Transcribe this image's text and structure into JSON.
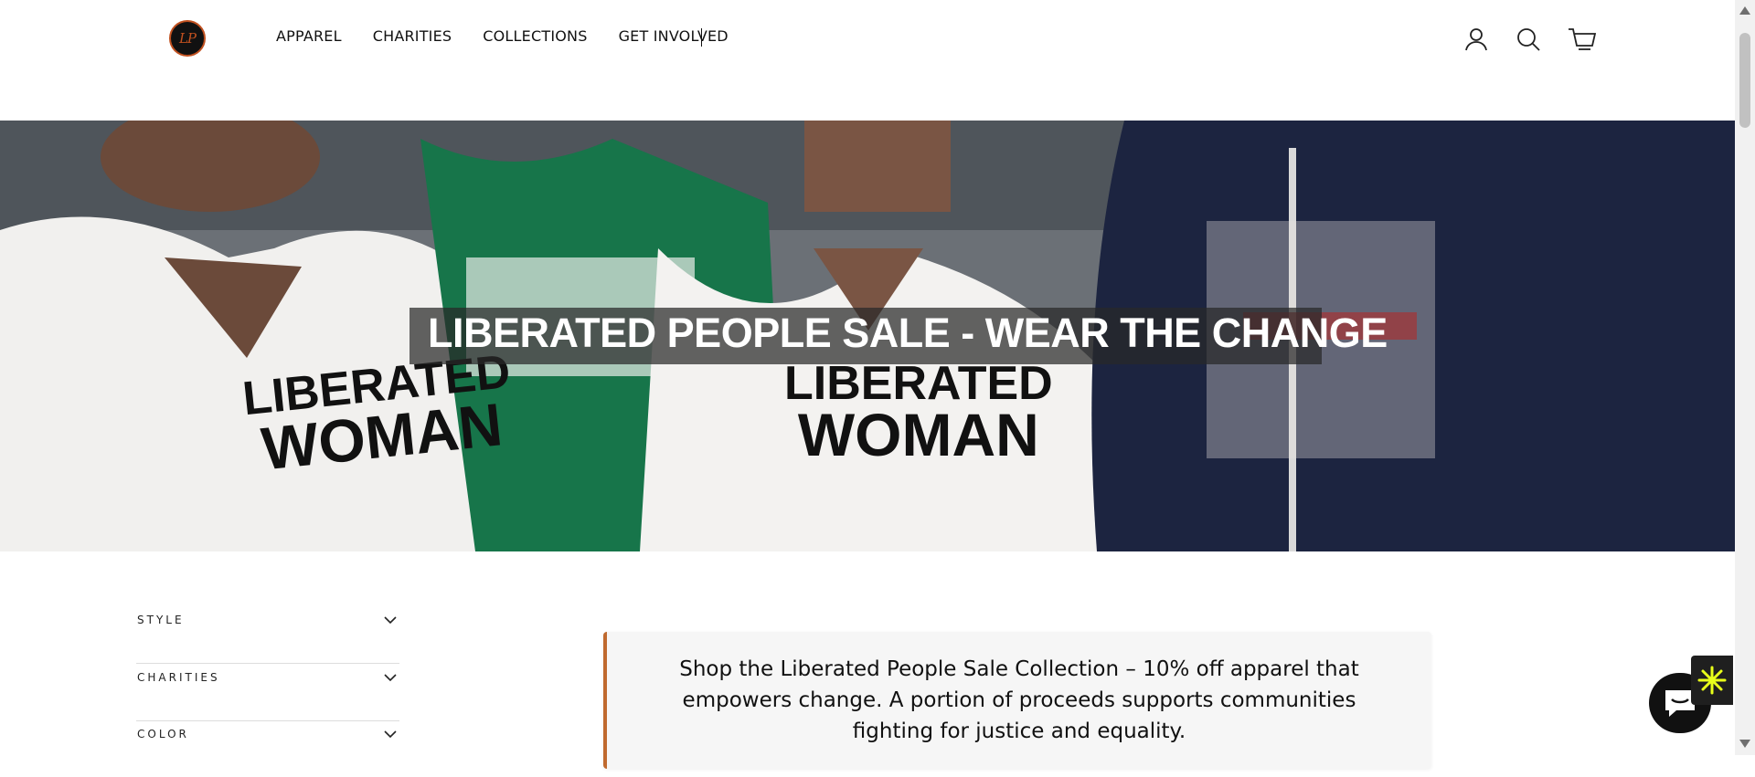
{
  "header": {
    "logo_text": "LP",
    "nav": [
      "APPAREL",
      "CHARITIES",
      "COLLECTIONS",
      "GET INVOLVED"
    ],
    "icons": [
      "account-icon",
      "search-icon",
      "cart-icon"
    ]
  },
  "hero": {
    "title": "LIBERATED PEOPLE SALE -  WEAR THE CHANGE",
    "shirt_text_1": "LIBERATED",
    "shirt_text_2": "WOMAN"
  },
  "filters": [
    "STYLE",
    "CHARITIES",
    "COLOR"
  ],
  "promo": {
    "text": "Shop the Liberated People Sale Collection – 10% off apparel that empowers change. A portion of proceeds supports communities fighting for justice and equality."
  },
  "colors": {
    "accent": "#c06a2f",
    "hoodie": "#1c2440",
    "green_shirt": "#17754a"
  }
}
